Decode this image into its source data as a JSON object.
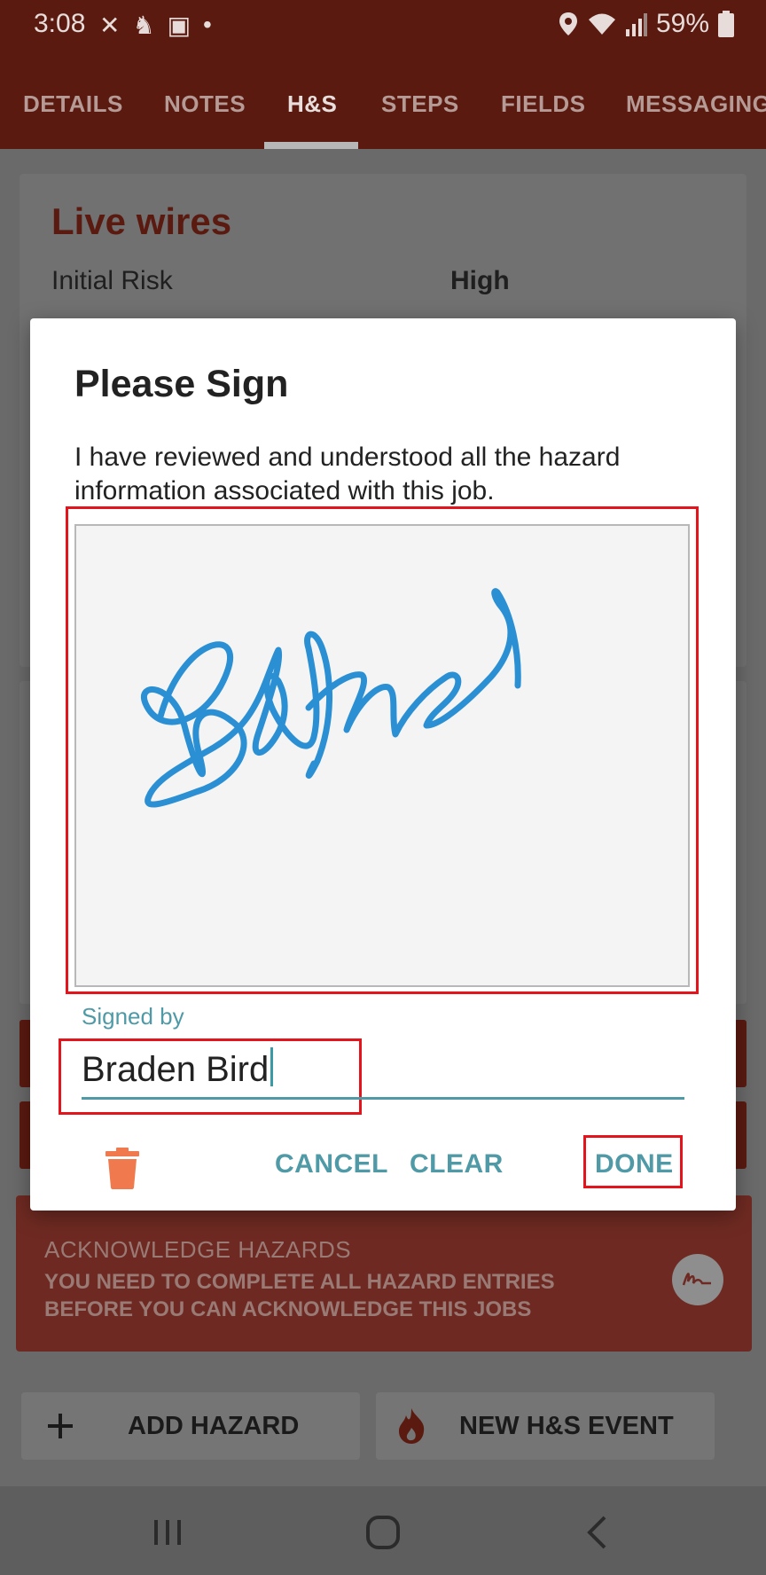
{
  "status_bar": {
    "time": "3:08",
    "battery": "59%"
  },
  "tabs": [
    {
      "label": "DETAILS"
    },
    {
      "label": "NOTES"
    },
    {
      "label": "H&S"
    },
    {
      "label": "STEPS"
    },
    {
      "label": "FIELDS"
    },
    {
      "label": "MESSAGING"
    }
  ],
  "active_tab": "H&S",
  "hazard": {
    "title": "Live wires",
    "risk_label": "Initial Risk",
    "risk_value": "High"
  },
  "acknowledge": {
    "title": "ACKNOWLEDGE HAZARDS",
    "message": "YOU NEED TO COMPLETE ALL HAZARD ENTRIES BEFORE YOU CAN ACKNOWLEDGE THIS JOBS"
  },
  "actions": {
    "add_hazard": "ADD HAZARD",
    "new_event": "NEW H&S EVENT"
  },
  "dialog": {
    "title": "Please Sign",
    "message": "I have reviewed and understood all the hazard information associated with this job.",
    "signed_by_label": "Signed by",
    "signed_by_value": "Braden Bird",
    "cancel_label": "CANCEL",
    "clear_label": "CLEAR",
    "done_label": "DONE"
  },
  "colors": {
    "accent": "#4f9aa6",
    "brand": "#5a1a10",
    "signature_ink": "#2b8fd4",
    "highlight": "#e3141c",
    "trash": "#f07a4d"
  }
}
